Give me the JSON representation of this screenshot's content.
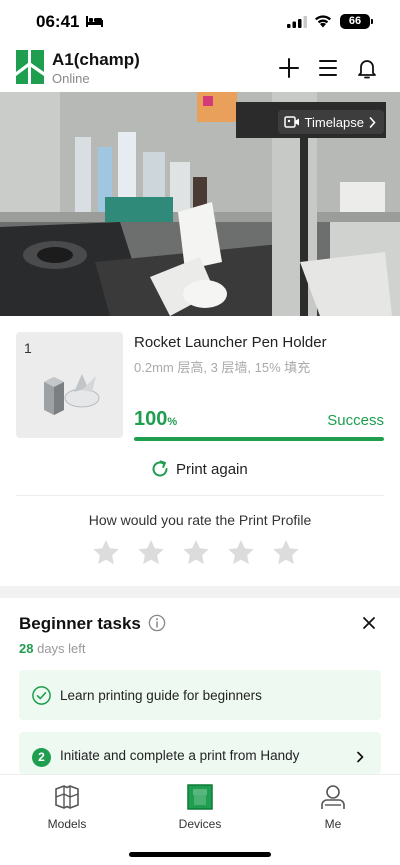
{
  "status_bar": {
    "time": "06:41",
    "battery": "66"
  },
  "header": {
    "printer_name": "A1(champ)",
    "status": "Online"
  },
  "camera": {
    "timelapse_label": "Timelapse"
  },
  "job": {
    "plate_number": "1",
    "title": "Rocket Launcher Pen Holder",
    "specs": "0.2mm 层高, 3 层墙, 15% 填充",
    "progress_value": "100",
    "progress_unit": "%",
    "progress_fraction": 1.0,
    "state": "Success",
    "print_again_label": "Print again"
  },
  "rating": {
    "question": "How would you rate the Print Profile",
    "stars_total": 5,
    "stars_selected": 0
  },
  "beginner_tasks": {
    "title": "Beginner tasks",
    "days_count": "28",
    "days_suffix": "days left",
    "tasks": [
      {
        "label": "Learn printing guide for beginners",
        "done": true
      },
      {
        "number": "2",
        "label": "Initiate and complete a print from Handy",
        "done": false
      }
    ]
  },
  "tabs": [
    {
      "label": "Models",
      "icon": "models-cube-icon",
      "active": false
    },
    {
      "label": "Devices",
      "icon": "device-printer-icon",
      "active": true
    },
    {
      "label": "Me",
      "icon": "person-icon",
      "active": false
    }
  ],
  "colors": {
    "accent_green": "#1f9e4f",
    "task_background": "#eefaf1",
    "muted_text": "#999999"
  }
}
